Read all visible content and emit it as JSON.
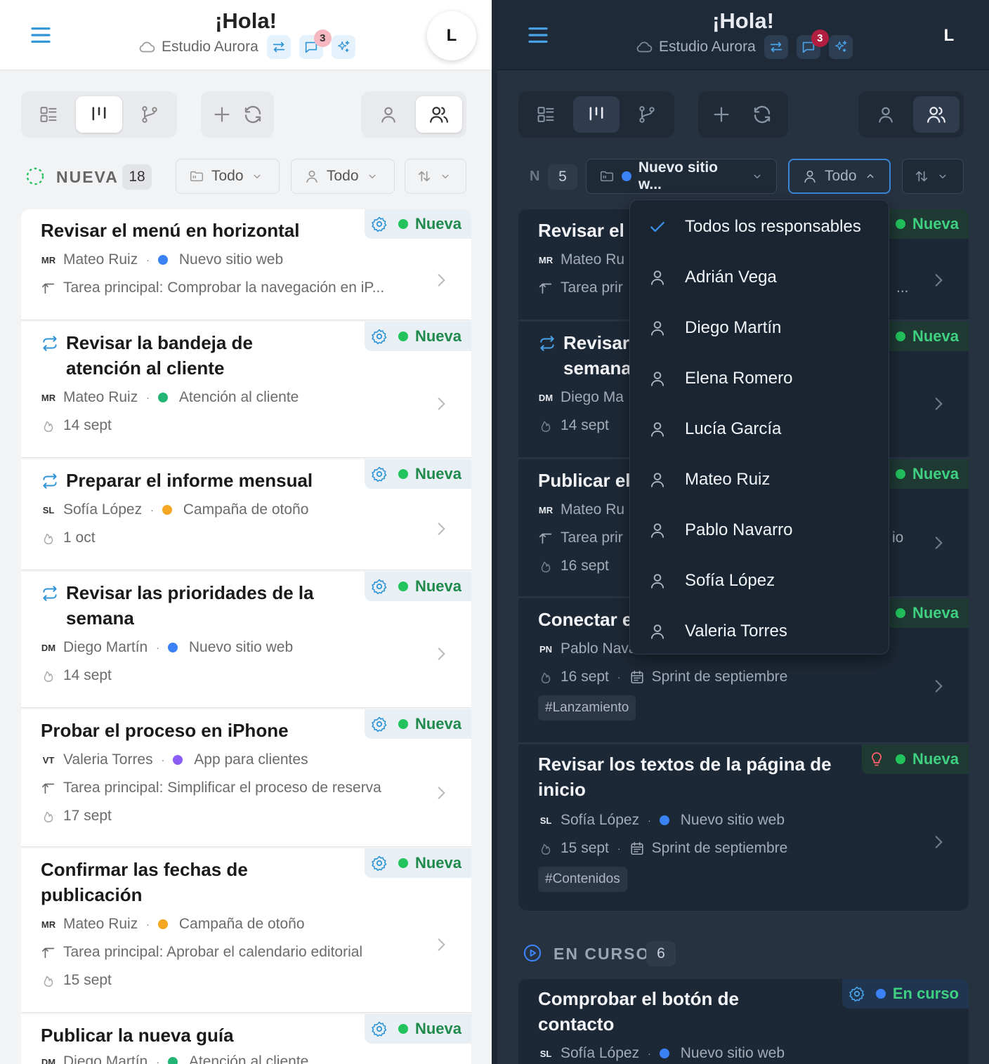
{
  "header": {
    "greeting": "¡Hola!",
    "workspace": "Estudio Aurora",
    "notifications": "3",
    "user_initial": "L",
    "icons": [
      "menu-icon",
      "cloud-icon",
      "swap-icon",
      "chat-icon",
      "sparkle-icon"
    ]
  },
  "colors": {
    "accent": "#2f95d6",
    "status_new": "#22c35d",
    "status_in_progress": "#3b82f6",
    "project_web": "#3b82f6",
    "project_support": "#22b573",
    "project_autumn": "#f5a623",
    "project_app": "#8b5cf6"
  },
  "light": {
    "section": {
      "title": "NUEVA",
      "count": "18"
    },
    "filters": {
      "project": "Todo",
      "assignee": "Todo"
    },
    "cards": [
      {
        "title": "Revisar el menú en horizontal",
        "initials": "MR",
        "assignee": "Mateo Ruiz",
        "project": "Nuevo sitio web",
        "parent": "Tarea principal: Comprobar la navegación en iP...",
        "status": "Nueva"
      },
      {
        "title": "Revisar la bandeja de atención al cliente",
        "initials": "MR",
        "assignee": "Mateo Ruiz",
        "project": "Atención al cliente",
        "date": "14 sept",
        "status": "Nueva"
      },
      {
        "title": "Preparar el informe mensual",
        "initials": "SL",
        "assignee": "Sofía López",
        "project": "Campaña de otoño",
        "date": "1 oct",
        "status": "Nueva"
      },
      {
        "title": "Revisar las prioridades de la semana",
        "initials": "DM",
        "assignee": "Diego Martín",
        "project": "Nuevo sitio web",
        "date": "14 sept",
        "status": "Nueva"
      },
      {
        "title": "Probar el proceso en iPhone",
        "initials": "VT",
        "assignee": "Valeria Torres",
        "project": "App para clientes",
        "parent": "Tarea principal: Simplificar el proceso de reserva",
        "date": "17 sept",
        "status": "Nueva"
      },
      {
        "title": "Confirmar las fechas de publicación",
        "initials": "MR",
        "assignee": "Mateo Ruiz",
        "project": "Campaña de otoño",
        "parent": "Tarea principal: Aprobar el calendario editorial",
        "date": "15 sept",
        "status": "Nueva"
      },
      {
        "title": "Publicar la nueva guía",
        "initials": "DM",
        "assignee": "Diego Martín",
        "project": "Atención al cliente",
        "status": "Nueva"
      }
    ]
  },
  "dark": {
    "section": {
      "count": "5"
    },
    "filters": {
      "project": "Nuevo sitio w...",
      "assignee": "Todo"
    },
    "cards": [
      {
        "title": "Revisar el",
        "initials": "MR",
        "assignee": "Mateo Ru",
        "parent": "Tarea prir",
        "parent_tail": "...",
        "status": "Nueva"
      },
      {
        "title": "Revisar",
        "title2": "semana",
        "initials": "DM",
        "assignee": "Diego Ma",
        "date": "14 sept",
        "status": "Nueva"
      },
      {
        "title": "Publicar el",
        "initials": "MR",
        "assignee": "Mateo Ru",
        "parent": "Tarea prir",
        "parent_tail": "io",
        "date": "16 sept",
        "status": "Nueva"
      },
      {
        "title": "Conectar e",
        "initials": "PN",
        "assignee": "Pablo Nava",
        "date": "16 sept",
        "sprint": "Sprint de septiembre",
        "tag": "#Lanzamiento",
        "status": "Nueva"
      },
      {
        "title": "Revisar los textos de la página de inicio",
        "initials": "SL",
        "assignee": "Sofía López",
        "project": "Nuevo sitio web",
        "date": "15 sept",
        "sprint": "Sprint de septiembre",
        "tag": "#Contenidos",
        "status": "Nueva"
      }
    ],
    "section2": {
      "title": "EN CURSO",
      "count": "6"
    },
    "cards2": [
      {
        "title": "Comprobar el botón de contacto",
        "initials": "SL",
        "assignee": "Sofía López",
        "project": "Nuevo sitio web",
        "status": "En curso"
      }
    ],
    "dropdown": {
      "selected": "Todos los responsables",
      "options": [
        "Adrián Vega",
        "Diego Martín",
        "Elena Romero",
        "Lucía García",
        "Mateo Ruiz",
        "Pablo Navarro",
        "Sofía López",
        "Valeria Torres"
      ]
    }
  }
}
